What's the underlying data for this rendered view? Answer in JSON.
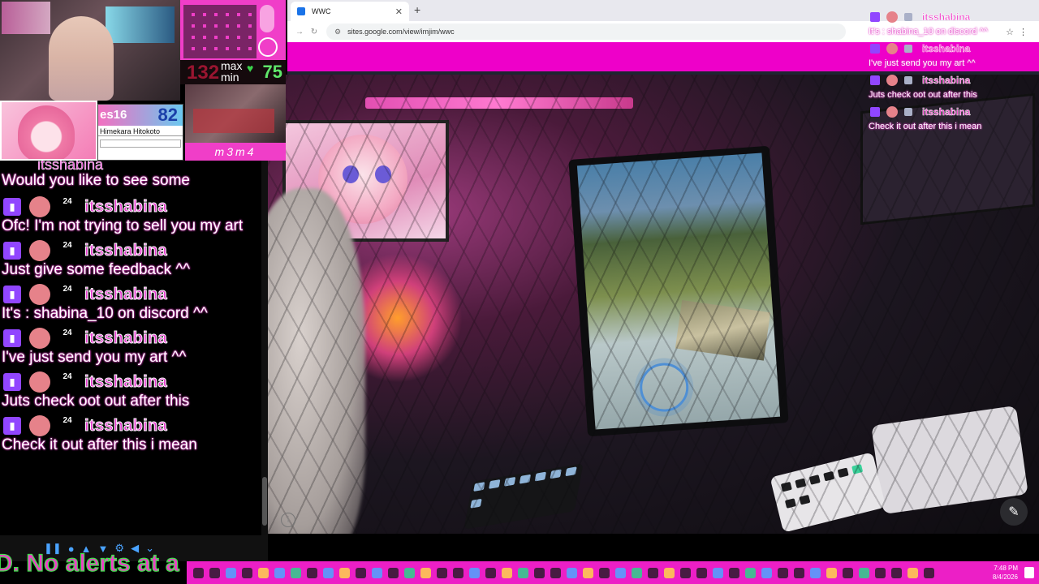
{
  "browser": {
    "tab_title": "WWC",
    "tab_close": "✕",
    "new_tab": "+",
    "url": "sites.google.com/view/imjim/wwc"
  },
  "hud": {
    "bpm_value": "132",
    "max_label": "max",
    "min_label": "min",
    "min_value": "75",
    "brand": "m3m4"
  },
  "nameplate": {
    "level": "es16",
    "score": "82",
    "name": "Himekara Hitokoto"
  },
  "chat": {
    "partial_username": "itsshabina",
    "partial_text": "Would you like to see some",
    "messages": [
      {
        "username": "itsshabina",
        "sub_badge": "24",
        "text": "Ofc! I'm not trying to sell you my art"
      },
      {
        "username": "itsshabina",
        "sub_badge": "24",
        "text": "Just give some feedback ^^"
      },
      {
        "username": "itsshabina",
        "sub_badge": "24",
        "text": "It's : shabina_10 on discord ^^"
      },
      {
        "username": "itsshabina",
        "sub_badge": "24",
        "text": "I've just send you my art ^^"
      },
      {
        "username": "itsshabina",
        "sub_badge": "24",
        "text": "Juts check oot out after this"
      },
      {
        "username": "itsshabina",
        "sub_badge": "24",
        "text": "Check it out after this i mean"
      }
    ]
  },
  "overlay_chat": {
    "messages": [
      {
        "username": "itsshabina",
        "text": "It's : shabina_10 on discord ^^"
      },
      {
        "username": "itsshabina",
        "text": "I've just send you my art ^^"
      },
      {
        "username": "itsshabina",
        "text": "Juts check oot out after this"
      },
      {
        "username": "itsshabina",
        "text": "Check it out after this i mean"
      }
    ]
  },
  "alerts": {
    "text": "D. No alerts at a"
  },
  "taskbar": {
    "time": "7:48 PM",
    "date": "8/4/2026"
  },
  "colors": {
    "accent_pink": "#ee00c9",
    "twitch_purple": "#9146ff",
    "username_pink": "#e73bd0"
  }
}
